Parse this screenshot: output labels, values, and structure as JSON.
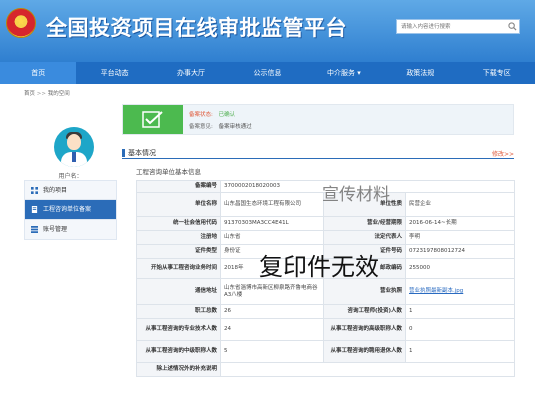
{
  "header": {
    "title": "全国投资项目在线审批监管平台",
    "search_placeholder": "请输入内容进行搜索"
  },
  "nav": [
    "首页",
    "平台动态",
    "办事大厅",
    "公示信息",
    "中介服务 ▾",
    "政策法规",
    "下载专区"
  ],
  "breadcrumb": {
    "home": "首页",
    "sep": ">>",
    "current": "我的空间"
  },
  "user": {
    "name": "用户名："
  },
  "side_menu": [
    "我的项目",
    "工程咨询单位备案",
    "账号管理"
  ],
  "status": {
    "state_label": "备案状态:",
    "state_value": "已确认",
    "opinion_label": "备案意见:",
    "opinion_value": "备案审核通过"
  },
  "section": {
    "title": "基本情况",
    "edit": "修改>>",
    "subtitle": "工程咨询单位基本信息"
  },
  "table": {
    "record_no_label": "备案编号",
    "record_no": "370000201802000​3",
    "unit_name_label": "单位名称",
    "unit_name": "山东昌国生态环境工程有限公司",
    "unit_nature_label": "单位性质",
    "unit_nature": "民营企业",
    "credit_code_label": "统一社会信用代码",
    "credit_code": "91370303MA3CC4E41L",
    "biz_term_label": "营业/经营期限",
    "biz_term": "2016-06-14~长期",
    "reg_place_label": "注册地",
    "reg_place": "山东省",
    "legal_rep_label": "法定代表人",
    "legal_rep": "李明",
    "cert_type_label": "证件类型",
    "cert_type": "身份证",
    "cert_no_label": "证件号码",
    "cert_no": "0723197808012724",
    "start_year_label": "开始从事工程咨询业务时间",
    "start_year": "2018年",
    "zip_label": "邮政编码",
    "zip": "255000",
    "address_label": "通信地址",
    "address": "山东省淄博市高新区柳泉路齐鲁电商谷A3八楼",
    "license_label": "营业执照",
    "license_link": "营业执照最新副本.jpg",
    "staff_label": "职工总数",
    "staff": "26",
    "invest_staff_label": "咨询工程师(投资)人数",
    "invest_staff": "1",
    "pro_tech_label": "从事工程咨询的专业技术人数",
    "pro_tech": "24",
    "senior_label": "从事工程咨询的高级职称人数",
    "senior": "0",
    "mid_label": "从事工程咨询的中级职称人数",
    "mid": "5",
    "retired_label": "从事工程咨询的聘用退休人数",
    "retired": "1",
    "notes_label": "除上述情况外的补充说明",
    "notes": ""
  },
  "watermarks": {
    "top": "宣传材料",
    "center": "复印件无效"
  },
  "colors": {
    "header_blue": "#2f7fd0",
    "nav_blue": "#1f6cc2",
    "status_green": "#4cba4f",
    "accent_red": "#e05b3c"
  }
}
